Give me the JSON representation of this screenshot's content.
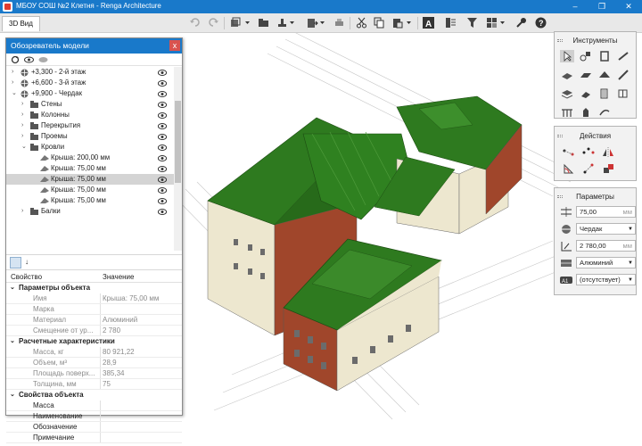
{
  "window": {
    "title": "МБОУ СОШ №2 Клетня - Renga Architecture",
    "buttons": [
      "–",
      "❐",
      "✕"
    ],
    "titlebar_color": "#1979ca"
  },
  "tabs": [
    {
      "label": "3D Вид"
    }
  ],
  "model_explorer": {
    "title": "Обозреватель модели",
    "close_label": "x",
    "tree": [
      {
        "label": "+3,300 - 2-й этаж",
        "level": 0,
        "icon": "level-icon",
        "expanded": false
      },
      {
        "label": "+6,600 - 3-й этаж",
        "level": 0,
        "icon": "level-icon",
        "expanded": false
      },
      {
        "label": "+9,900 - Чердак",
        "level": 0,
        "icon": "level-icon",
        "expanded": true
      },
      {
        "label": "Стены",
        "level": 1,
        "icon": "folder-icon",
        "expanded": false
      },
      {
        "label": "Колонны",
        "level": 1,
        "icon": "folder-icon",
        "expanded": false
      },
      {
        "label": "Перекрытия",
        "level": 1,
        "icon": "folder-icon",
        "expanded": false
      },
      {
        "label": "Проемы",
        "level": 1,
        "icon": "folder-icon",
        "expanded": false
      },
      {
        "label": "Кровли",
        "level": 1,
        "icon": "folder-icon",
        "expanded": true
      },
      {
        "label": "Крыша: 200,00 мм",
        "level": 2,
        "icon": "roof-icon"
      },
      {
        "label": "Крыша: 75,00 мм",
        "level": 2,
        "icon": "roof-icon"
      },
      {
        "label": "Крыша: 75,00 мм",
        "level": 2,
        "icon": "roof-icon",
        "selected": true
      },
      {
        "label": "Крыша: 75,00 мм",
        "level": 2,
        "icon": "roof-icon"
      },
      {
        "label": "Крыша: 75,00 мм",
        "level": 2,
        "icon": "roof-icon"
      },
      {
        "label": "Балки",
        "level": 1,
        "icon": "folder-icon",
        "expanded": false
      }
    ],
    "properties": {
      "col_property": "Свойство",
      "col_value": "Значение",
      "groups": [
        {
          "title": "Параметры объекта",
          "rows": [
            {
              "k": "Имя",
              "v": "Крыша: 75,00 мм"
            },
            {
              "k": "Марка",
              "v": ""
            },
            {
              "k": "Материал",
              "v": "Алюминий"
            },
            {
              "k": "Смещение от ур...",
              "v": "2 780"
            }
          ]
        },
        {
          "title": "Расчетные характеристики",
          "rows": [
            {
              "k": "Масса, кг",
              "v": "80 921,22"
            },
            {
              "k": "Объем, м³",
              "v": "28,9"
            },
            {
              "k": "Площадь поверх...",
              "v": "385,34"
            },
            {
              "k": "Толщина, мм",
              "v": "75"
            }
          ]
        },
        {
          "title": "Свойства объекта",
          "rows": [
            {
              "k": "Масса",
              "v": "",
              "dark": true
            },
            {
              "k": "Наименование",
              "v": "",
              "dark": true
            },
            {
              "k": "Обозначение",
              "v": "",
              "dark": true
            },
            {
              "k": "Примечание",
              "v": "",
              "dark": true
            }
          ]
        }
      ]
    }
  },
  "instruments_panel": {
    "title": "Инструменты"
  },
  "actions_panel": {
    "title": "Действия"
  },
  "parameters_panel": {
    "title": "Параметры",
    "fields": [
      {
        "value": "75,00",
        "unit": "мм",
        "icon": "thickness-icon"
      },
      {
        "value": "Чердак",
        "dropdown": true,
        "icon": "level-icon"
      },
      {
        "value": "2 780,00",
        "unit": "мм",
        "icon": "offset-icon"
      },
      {
        "value": "Алюминий",
        "dropdown": true,
        "icon": "material-icon"
      },
      {
        "value": "(отсутствует)",
        "dropdown": true,
        "icon": "mark-icon"
      }
    ]
  },
  "colors": {
    "roof": "#2e7a1f",
    "brick": "#a0462b",
    "wall": "#ece6cf"
  }
}
